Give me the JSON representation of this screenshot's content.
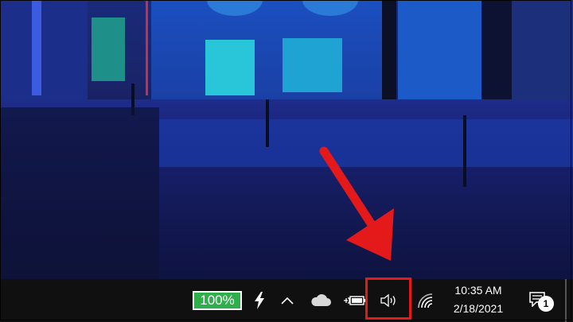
{
  "taskbar": {
    "battery_percent_label": "100%",
    "clock_time": "10:35 AM",
    "clock_date": "2/18/2021",
    "notification_count": "1"
  },
  "icons": {
    "charging": "lightning-icon",
    "show_hidden": "chevron-up-icon",
    "cloud": "onedrive-cloud-icon",
    "power": "battery-plugged-icon",
    "volume": "speaker-icon",
    "wifi": "wifi-icon",
    "notifications": "action-center-icon"
  },
  "colors": {
    "taskbar_bg": "#101010",
    "battery_green": "#2fae4c",
    "annotation_red": "#e41a1a"
  }
}
